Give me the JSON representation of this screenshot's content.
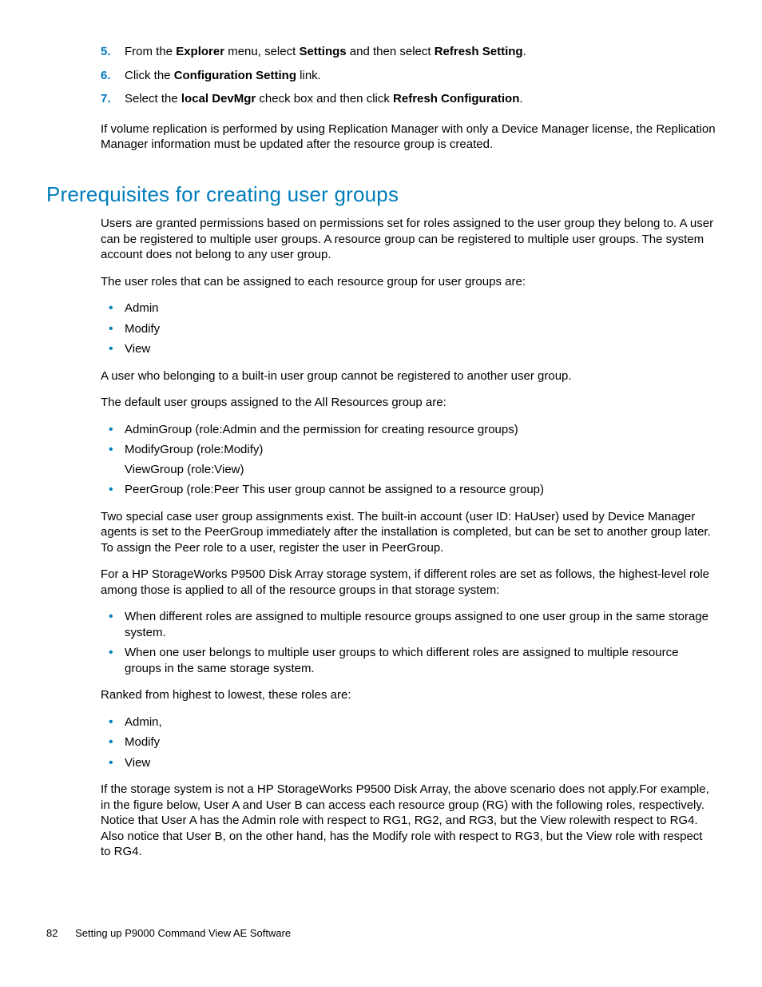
{
  "steps": [
    {
      "num": "5.",
      "segments": [
        {
          "t": "From the "
        },
        {
          "t": "Explorer",
          "b": true
        },
        {
          "t": " menu, select "
        },
        {
          "t": "Settings",
          "b": true
        },
        {
          "t": " and then select "
        },
        {
          "t": "Refresh Setting",
          "b": true
        },
        {
          "t": "."
        }
      ]
    },
    {
      "num": "6.",
      "segments": [
        {
          "t": "Click the "
        },
        {
          "t": "Configuration Setting",
          "b": true
        },
        {
          "t": " link."
        }
      ]
    },
    {
      "num": "7.",
      "segments": [
        {
          "t": "Select the "
        },
        {
          "t": "local DevMgr",
          "b": true
        },
        {
          "t": " check box and then click "
        },
        {
          "t": "Refresh Configuration",
          "b": true
        },
        {
          "t": "."
        }
      ]
    }
  ],
  "post_steps_para": "If volume replication is performed by using Replication Manager with only a Device Manager license, the Replication Manager information must be updated after the resource group is created.",
  "section_heading": "Prerequisites for creating user groups",
  "para1": "Users are granted permissions based on permissions set for roles assigned to the user group they belong to. A user can be registered to multiple user groups. A resource group can be registered to multiple user groups. The system account does not belong to any user group.",
  "para2": "The user roles that can be assigned to each resource group for user groups are:",
  "roles1": [
    "Admin",
    "Modify",
    "View"
  ],
  "para3": "A user who belonging to a built-in user group cannot be registered to another user group.",
  "para4": "The default user groups assigned to the All Resources group are:",
  "groups": [
    {
      "main": "AdminGroup (role:Admin and the permission for creating resource groups)"
    },
    {
      "main": "ModifyGroup (role:Modify)",
      "sub": "ViewGroup (role:View)"
    },
    {
      "main": "PeerGroup (role:Peer This user group cannot be assigned to a resource group)"
    }
  ],
  "para5": "Two special case user group assignments exist. The built-in account (user ID: HaUser) used by Device Manager agents is set to the PeerGroup immediately after the installation is completed, but can be set to another group later. To assign the Peer role to a user, register the user in PeerGroup.",
  "para6": "For a HP StorageWorks P9500 Disk Array storage system, if different roles are set as follows, the highest-level role among those is applied to all of the resource groups in that storage system:",
  "cases": [
    "When different roles are assigned to multiple resource groups assigned to one user group in the same storage system.",
    "When one user belongs to multiple user groups to which different roles are assigned to multiple resource groups in the same storage system."
  ],
  "para7": "Ranked from highest to lowest, these roles are:",
  "roles2": [
    "Admin,",
    "Modify",
    "View"
  ],
  "para8": "If the storage system is not a HP StorageWorks P9500 Disk Array, the above scenario does not apply.For example, in the figure below, User A and User B can access each resource group (RG) with the following roles, respectively. Notice that User A has the Admin role with respect to RG1, RG2, and RG3, but the View rolewith respect to RG4. Also notice that User B, on the other hand, has the Modify role with respect to RG3, but the View role with respect to RG4.",
  "footer": {
    "page": "82",
    "title": "Setting up P9000 Command View AE Software"
  }
}
